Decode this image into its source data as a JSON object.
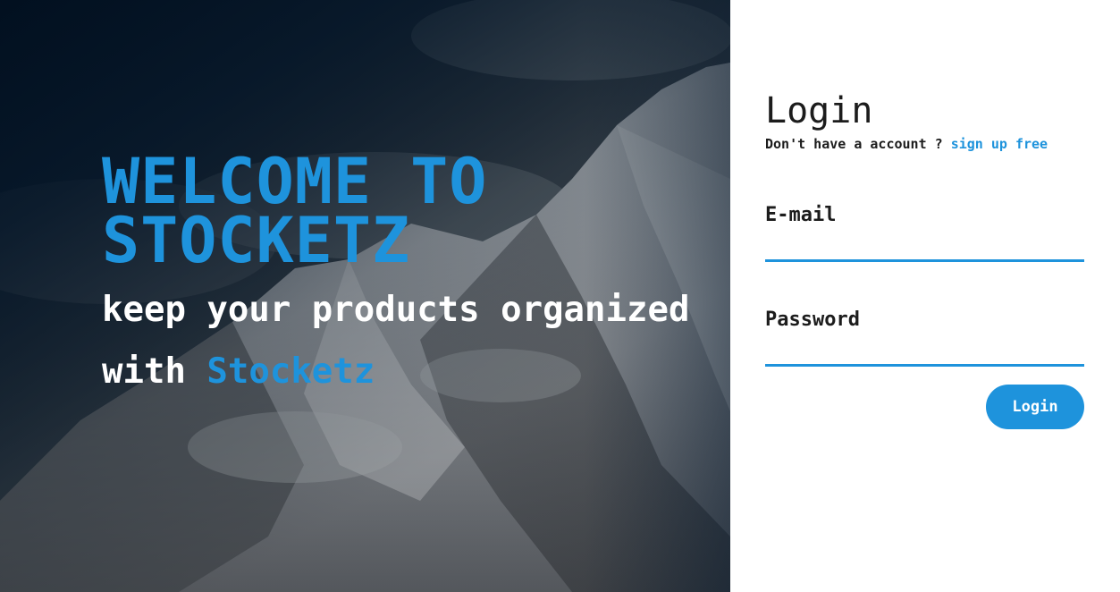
{
  "hero": {
    "welcome_title": "WELCOME TO STOCKETZ",
    "tagline_prefix": "keep your products organized with ",
    "tagline_brand": "Stocketz"
  },
  "login": {
    "title": "Login",
    "no_account_text": "Don't have a account ? ",
    "signup_link": "sign up free",
    "email_label": "E-mail",
    "email_value": "",
    "password_label": "Password",
    "password_value": "",
    "submit_label": "Login"
  },
  "colors": {
    "accent": "#1e93dc",
    "text_dark": "#1c1c1c",
    "panel_bg": "#ffffff"
  }
}
